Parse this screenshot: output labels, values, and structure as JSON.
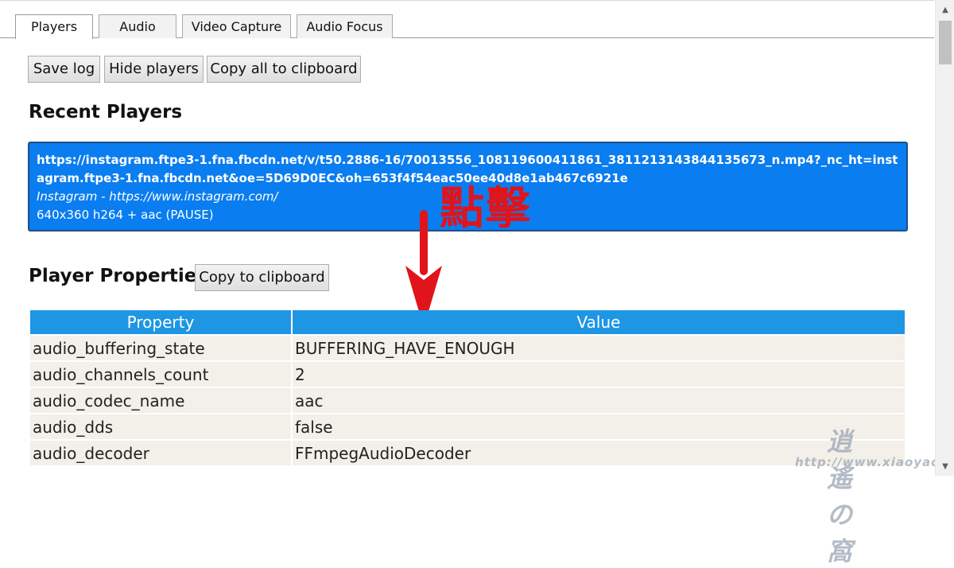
{
  "tabs": [
    {
      "label": "Players"
    },
    {
      "label": "Audio"
    },
    {
      "label": "Video Capture"
    },
    {
      "label": "Audio Focus"
    }
  ],
  "toolbar": {
    "save_log": "Save log",
    "hide_players": "Hide players",
    "copy_all": "Copy all to clipboard"
  },
  "recent": {
    "heading": "Recent Players",
    "url": "https://instagram.ftpe3-1.fna.fbcdn.net/v/t50.2886-16/70013556_108119600411861_3811213143844135673_n.mp4?_nc_ht=instagram.ftpe3-1.fna.fbcdn.net&oe=5D69D0EC&oh=653f4f54eac50ee40d8e1ab467c6921e",
    "origin": "Instagram - https://www.instagram.com/",
    "info": "640x360 h264 + aac (PAUSE)"
  },
  "annotation": {
    "text": "點擊",
    "color": "#e0141a"
  },
  "properties": {
    "heading": "Player Properties",
    "copy_label": "Copy to clipboard",
    "columns": [
      "Property",
      "Value"
    ],
    "rows": [
      {
        "property": "audio_buffering_state",
        "value": "BUFFERING_HAVE_ENOUGH"
      },
      {
        "property": "audio_channels_count",
        "value": "2"
      },
      {
        "property": "audio_codec_name",
        "value": "aac"
      },
      {
        "property": "audio_dds",
        "value": "false"
      },
      {
        "property": "audio_decoder",
        "value": "FFmpegAudioDecoder"
      }
    ]
  },
  "watermark": {
    "logo": "逍遙の窩",
    "url": "http://www.xiaoyao.tw/"
  },
  "colors": {
    "player_box": "#0a7df0",
    "table_header": "#1e96e3",
    "table_cell": "#f3efe9"
  }
}
